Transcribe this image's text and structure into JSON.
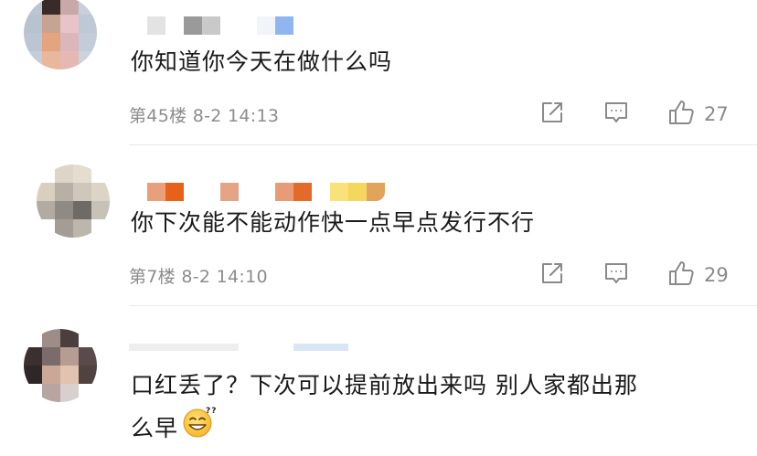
{
  "comments": [
    {
      "text": "你知道你今天在做什么吗",
      "floor_time": "第45楼 8-2 14:13",
      "likes": "27"
    },
    {
      "text": "你下次能不能动作快一点早点发行不行",
      "floor_time": "第7楼 8-2 14:10",
      "likes": "29"
    },
    {
      "text_line1": "口红丢了？下次可以提前放出来吗 别人家都出那",
      "text_line2": "么早"
    }
  ],
  "icons": {
    "share": "share-icon",
    "reply": "comment-icon",
    "like": "thumbs-up-icon",
    "emoji": "grinning-emoji-icon"
  },
  "colors": {
    "text": "#1a1a1a",
    "meta": "#8c8c8c",
    "icon": "#8a8a8a",
    "divider": "#e9e9e9"
  }
}
